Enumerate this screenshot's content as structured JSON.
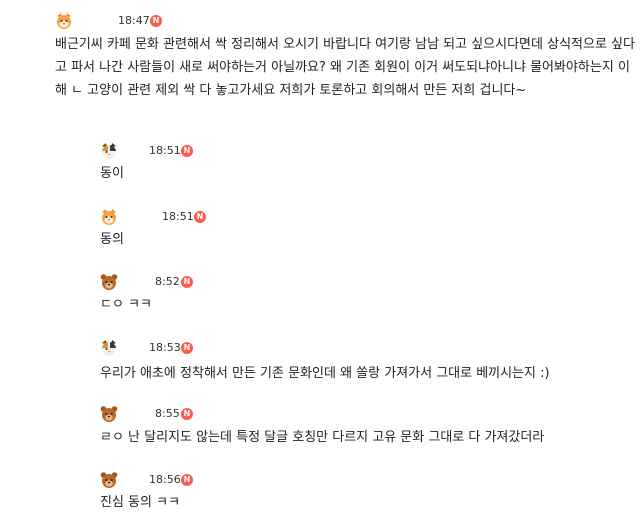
{
  "badge": "N",
  "messages": [
    {
      "avatar": "cat-orange-avatar-icon",
      "time": "18:47",
      "text": "배근기씨 카페 문화 관련해서 싹 정리해서 오시기 바랍니다 여기랑 남남 되고 싶으시다면데 상식적으로 싶다고 파서 나간 사람들이 새로 써야하는거 아닐까요? 왜 기존 회원이 이거 써도되냐아니냐 물어봐야하는지 이해 ㄴ 고양이 관련 제외 싹 다 놓고가세요 저희가 토론하고 회의해서 만든 저희 겁니다~"
    },
    {
      "avatar": "calico-cat-avatar-icon",
      "time": "18:51",
      "text": "동이"
    },
    {
      "avatar": "cat-orange-avatar-icon",
      "time": "18:51",
      "text": "동의"
    },
    {
      "avatar": "bear-avatar-icon",
      "time": "8:52",
      "text": "ㄷㅇ ㅋㅋ"
    },
    {
      "avatar": "calico-cat-avatar-icon",
      "time": "18:53",
      "text": "우리가 애초에 정착해서 만든 기존 문화인데 왜 쏠랑 가져가서 그대로 베끼시는지 :)"
    },
    {
      "avatar": "bear-avatar-icon",
      "time": "8:55",
      "text": "ㄹㅇ 난 달리지도 않는데 특정 달글 호칭만 다르지 고유 문화 그대로 다 가져갔더라"
    },
    {
      "avatar": "bear-avatar-icon",
      "time": "18:56",
      "text": "진심 동의 ㅋㅋ"
    }
  ]
}
